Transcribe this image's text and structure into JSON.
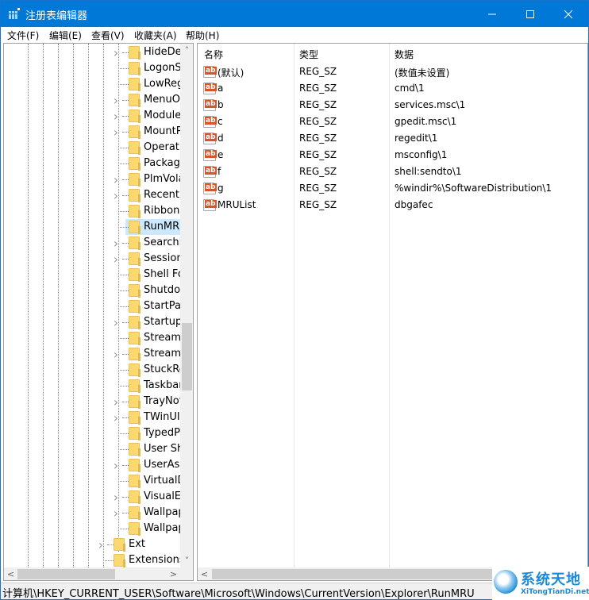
{
  "window": {
    "title": "注册表编辑器",
    "controls": {
      "minimize": "—",
      "maximize": "☐",
      "close": "✕"
    }
  },
  "menubar": [
    "文件(F)",
    "编辑(E)",
    "查看(V)",
    "收藏夹(A)",
    "帮助(H)"
  ],
  "tree": {
    "items": [
      {
        "label": "HideDes",
        "expandable": true
      },
      {
        "label": "LogonSt",
        "expandable": false
      },
      {
        "label": "LowReg",
        "expandable": false
      },
      {
        "label": "MenuOr",
        "expandable": true
      },
      {
        "label": "Module",
        "expandable": true
      },
      {
        "label": "MountP",
        "expandable": true
      },
      {
        "label": "Operati",
        "expandable": false
      },
      {
        "label": "Package",
        "expandable": false
      },
      {
        "label": "PlmVola",
        "expandable": true
      },
      {
        "label": "RecentD",
        "expandable": true
      },
      {
        "label": "Ribbon",
        "expandable": false
      },
      {
        "label": "RunMRU",
        "expandable": false,
        "selected": true
      },
      {
        "label": "SearchP",
        "expandable": true
      },
      {
        "label": "Session",
        "expandable": true
      },
      {
        "label": "Shell Fo",
        "expandable": false
      },
      {
        "label": "Shutdov",
        "expandable": false
      },
      {
        "label": "StartPag",
        "expandable": false
      },
      {
        "label": "StartupA",
        "expandable": true
      },
      {
        "label": "StreamM",
        "expandable": false
      },
      {
        "label": "Streams",
        "expandable": true
      },
      {
        "label": "StuckRe",
        "expandable": false
      },
      {
        "label": "Taskbar",
        "expandable": false
      },
      {
        "label": "TrayNot",
        "expandable": true
      },
      {
        "label": "TWinUI",
        "expandable": true
      },
      {
        "label": "TypedPa",
        "expandable": false
      },
      {
        "label": "User Sh",
        "expandable": false
      },
      {
        "label": "UserAss",
        "expandable": true
      },
      {
        "label": "VirtualD",
        "expandable": false
      },
      {
        "label": "VisualEf",
        "expandable": true
      },
      {
        "label": "Wallpap",
        "expandable": true
      },
      {
        "label": "Wallpap",
        "expandable": false
      }
    ],
    "parent_items": [
      {
        "label": "Ext",
        "expandable": true
      },
      {
        "label": "Extensions",
        "expandable": false
      }
    ],
    "scroll": {
      "vertical_position": 0.62,
      "horizontal_position": 0.0
    }
  },
  "list": {
    "headers": {
      "name": "名称",
      "type": "类型",
      "data": "数据"
    },
    "icon": "ab",
    "rows": [
      {
        "name": "(默认)",
        "type": "REG_SZ",
        "data": "(数值未设置)"
      },
      {
        "name": "a",
        "type": "REG_SZ",
        "data": "cmd\\1"
      },
      {
        "name": "b",
        "type": "REG_SZ",
        "data": "services.msc\\1"
      },
      {
        "name": "c",
        "type": "REG_SZ",
        "data": "gpedit.msc\\1"
      },
      {
        "name": "d",
        "type": "REG_SZ",
        "data": "regedit\\1"
      },
      {
        "name": "e",
        "type": "REG_SZ",
        "data": "msconfig\\1"
      },
      {
        "name": "f",
        "type": "REG_SZ",
        "data": "shell:sendto\\1"
      },
      {
        "name": "g",
        "type": "REG_SZ",
        "data": "%windir%\\SoftwareDistribution\\1"
      },
      {
        "name": "MRUList",
        "type": "REG_SZ",
        "data": "dbgafec"
      }
    ]
  },
  "scroll_arrows": {
    "up": "˄",
    "down": "˅",
    "left": "<",
    "right": ">"
  },
  "statusbar": {
    "path": "计算机\\HKEY_CURRENT_USER\\Software\\Microsoft\\Windows\\CurrentVersion\\Explorer\\RunMRU"
  },
  "watermark": {
    "cn": "系统天地",
    "en": "XiTongTianDi.net"
  },
  "colors": {
    "titlebar": "#0078d7",
    "selection": "#cce8ff",
    "folder": "#fcd871",
    "ab_icon": "#d8552c"
  }
}
